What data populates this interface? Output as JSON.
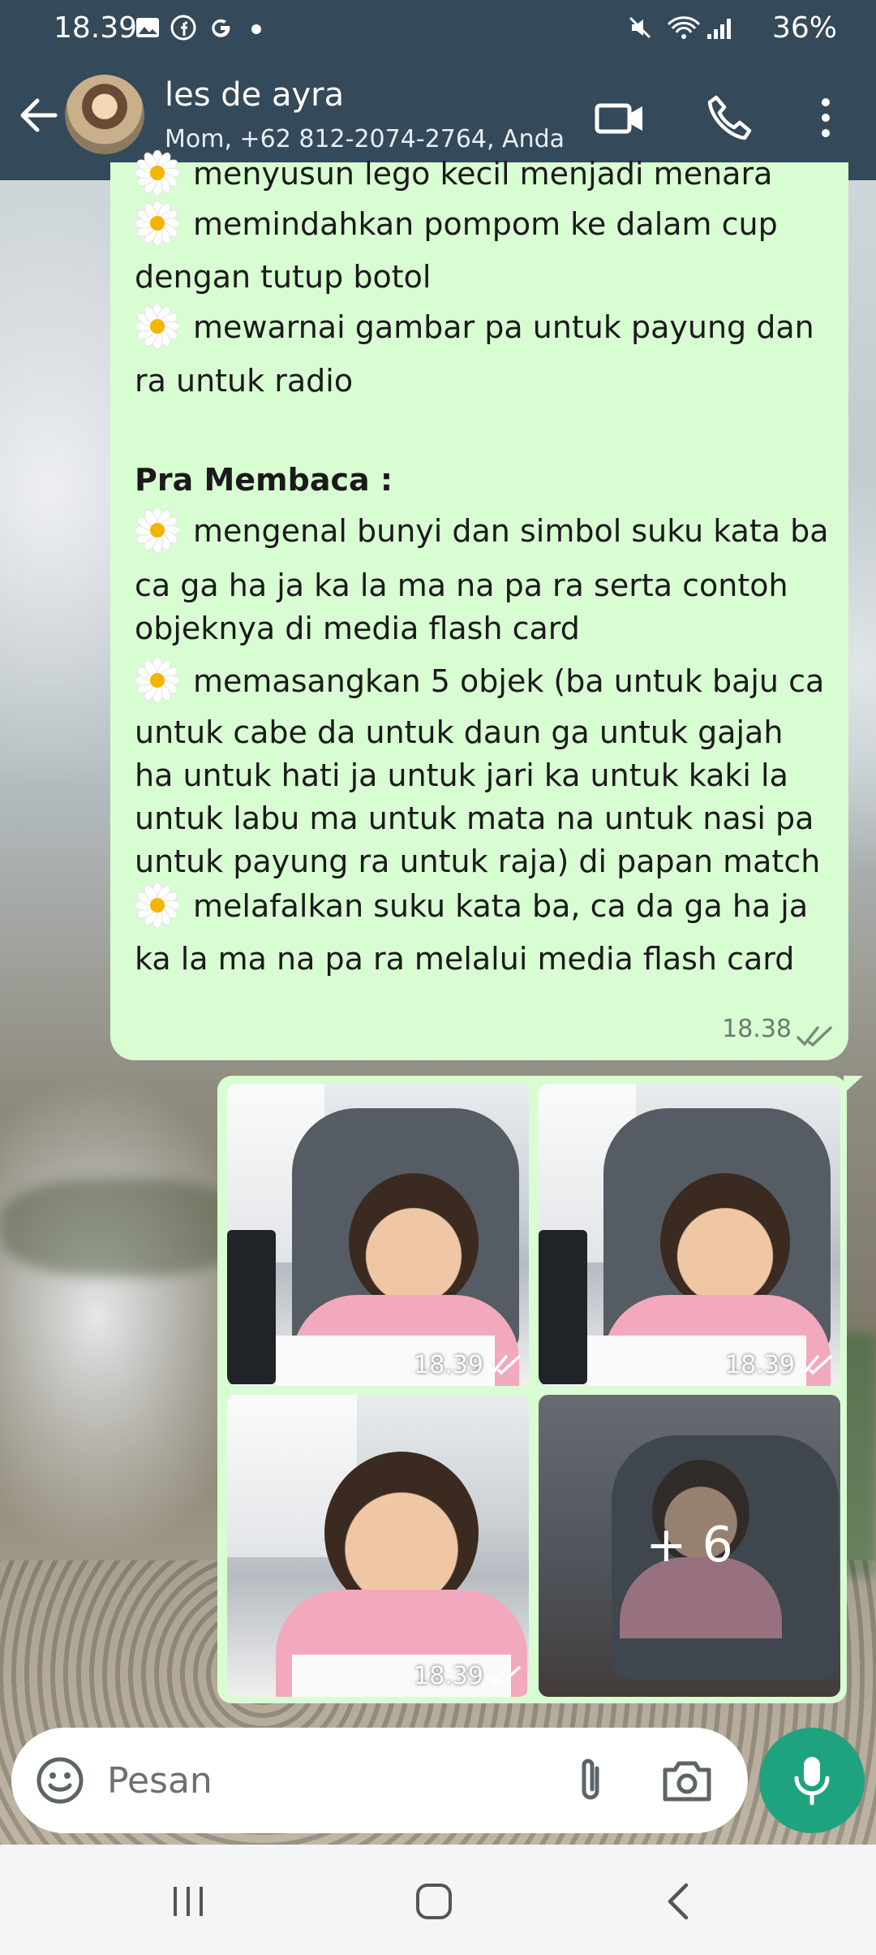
{
  "status_bar": {
    "time": "18.39",
    "battery": "36%",
    "icons": [
      "gallery-icon",
      "facebook-icon",
      "google-icon",
      "dot-icon",
      "mute-icon",
      "wifi-icon",
      "signal-icon",
      "battery-icon"
    ]
  },
  "header": {
    "title": "les de ayra",
    "subtitle": "Mom, +62 812-2074-2764, Anda",
    "icons": [
      "back-arrow-icon",
      "video-call-icon",
      "phone-icon",
      "more-vert-icon"
    ]
  },
  "message": {
    "lines": [
      {
        "daisy": true,
        "text": "menyusun lego kecil menjadi menara",
        "bold": false
      },
      {
        "daisy": true,
        "text": "memindahkan pompom ke dalam cup",
        "bold": false
      },
      {
        "daisy": false,
        "text": "dengan tutup botol",
        "bold": false
      },
      {
        "daisy": true,
        "text": "mewarnai gambar pa untuk payung dan",
        "bold": false
      },
      {
        "daisy": false,
        "text": "ra untuk radio",
        "bold": false
      },
      {
        "daisy": false,
        "text": "Pra Membaca :",
        "bold": true
      },
      {
        "daisy": true,
        "text": "mengenal bunyi dan simbol suku kata ba",
        "bold": false
      },
      {
        "daisy": false,
        "text": "ca ga ha ja ka la ma na pa ra serta contoh",
        "bold": false
      },
      {
        "daisy": false,
        "text": "objeknya di media flash card",
        "bold": false
      },
      {
        "daisy": true,
        "text": "memasangkan 5 objek (ba untuk baju ca",
        "bold": false
      },
      {
        "daisy": false,
        "text": "untuk cabe da untuk daun ga untuk gajah",
        "bold": false
      },
      {
        "daisy": false,
        "text": "ha untuk hati ja untuk jari ka untuk kaki la",
        "bold": false
      },
      {
        "daisy": false,
        "text": "untuk labu ma untuk mata na untuk nasi pa",
        "bold": false
      },
      {
        "daisy": false,
        "text": "untuk payung ra untuk raja) di papan match",
        "bold": false
      },
      {
        "daisy": true,
        "text": "melafalkan suku kata ba, ca da ga ha ja",
        "bold": false
      },
      {
        "daisy": false,
        "text": "ka la ma na pa ra melalui media flash card",
        "bold": false
      }
    ],
    "time": "18.38"
  },
  "media": {
    "photos": [
      {
        "time": "18.39"
      },
      {
        "time": "18.39"
      },
      {
        "time": "18.39"
      },
      {
        "more": "+ 6"
      }
    ]
  },
  "composer": {
    "placeholder": "Pesan"
  },
  "colors": {
    "header_bg": "#34495a",
    "bubble_bg": "#d9fdd3",
    "mic_bg": "#1fa37e"
  }
}
